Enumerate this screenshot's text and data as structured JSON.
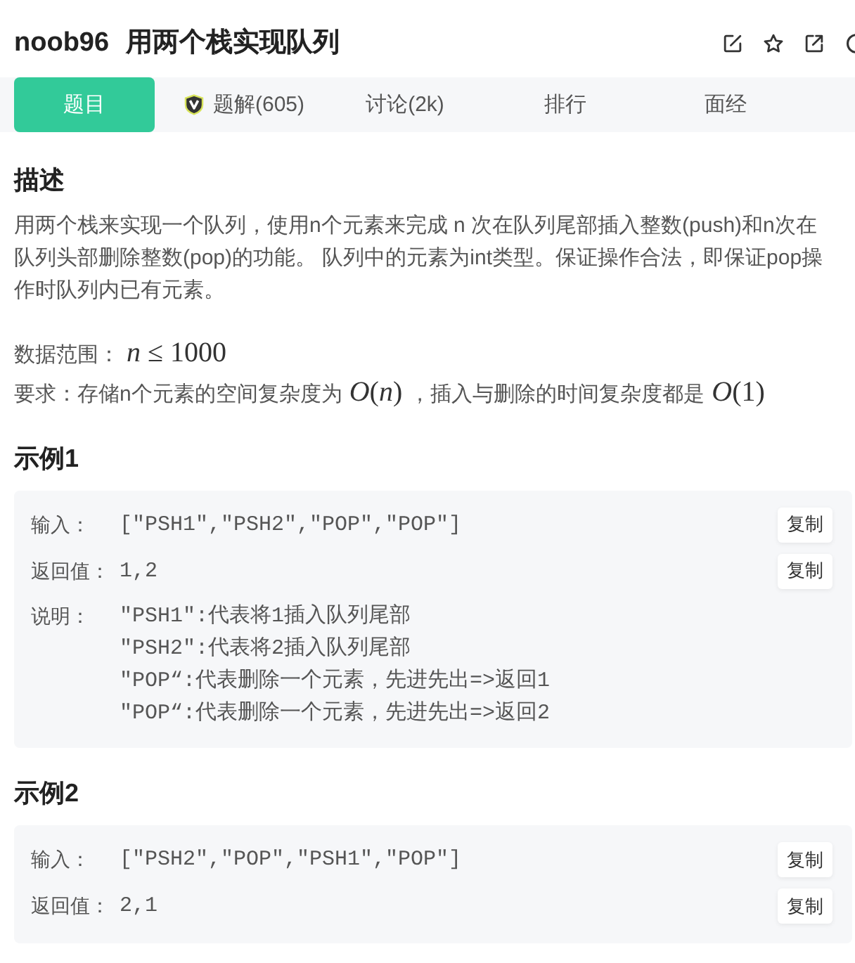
{
  "header": {
    "problem_id": "noob96",
    "title": "用两个栈实现队列"
  },
  "tabs": [
    {
      "label": "题目",
      "selected": true,
      "kind": "plain"
    },
    {
      "label": "题解(605)",
      "selected": false,
      "kind": "icon"
    },
    {
      "label": "讨论(2k)",
      "selected": false,
      "kind": "plain"
    },
    {
      "label": "排行",
      "selected": false,
      "kind": "plain"
    },
    {
      "label": "面经",
      "selected": false,
      "kind": "plain"
    }
  ],
  "description": {
    "heading": "描述",
    "paragraphs": [
      [
        {
          "kind": "text",
          "text": "用两个栈来实现一个队列，使用n个元素来完成 n 次在队列尾部插入整数(push)和n次在队列头部删除整数(pop)的功能。 队列中的元素为int类型。保证操作合法，即保证pop操作时队列内已有元素。"
        }
      ],
      [
        {
          "kind": "text",
          "text": "数据范围："
        },
        {
          "kind": "math",
          "text": "*n* ≤ 1000"
        }
      ],
      [
        {
          "kind": "text",
          "text": "要求：存储n个元素的空间复杂度为"
        },
        {
          "kind": "math",
          "text": "*O*(*n*)"
        },
        {
          "kind": "text",
          "text": "，插入与删除的时间复杂度都是"
        },
        {
          "kind": "math",
          "text": "*O*(1)"
        }
      ]
    ]
  },
  "examples": [
    {
      "heading": "示例1",
      "rows": [
        {
          "kind": "value",
          "label": "输入：",
          "value": "[\"PSH1\",\"PSH2\",\"POP\",\"POP\"]",
          "button": "复制"
        },
        {
          "kind": "value",
          "label": "返回值：",
          "value": "1,2",
          "button": "复制"
        },
        {
          "kind": "note",
          "label": "说明：",
          "lines": [
            "\"PSH1\":代表将1插入队列尾部",
            "\"PSH2\":代表将2插入队列尾部",
            "\"POP“:代表删除一个元素，先进先出=>返回1",
            "\"POP“:代表删除一个元素，先进先出=>返回2"
          ]
        }
      ]
    },
    {
      "heading": "示例2",
      "rows": [
        {
          "kind": "value",
          "label": "输入：",
          "value": "[\"PSH2\",\"POP\",\"PSH1\",\"POP\"]",
          "button": "复制"
        },
        {
          "kind": "value",
          "label": "返回值：",
          "value": "2,1",
          "button": "复制"
        }
      ]
    }
  ]
}
